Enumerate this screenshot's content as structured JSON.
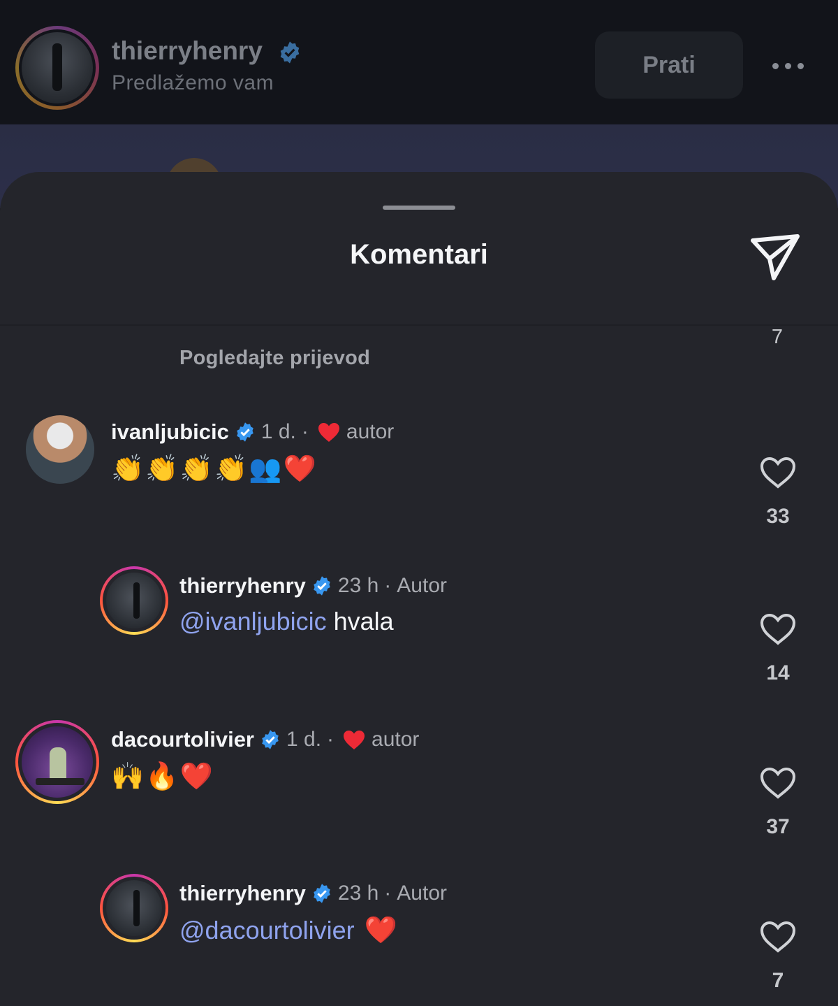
{
  "header": {
    "username": "thierryhenry",
    "subtitle": "Predlažemo vam",
    "follow_label": "Prati"
  },
  "sheet": {
    "title": "Komentari"
  },
  "partial_comment": {
    "like_count": "7",
    "see_translation": "Pogledajte prijevod"
  },
  "comments": [
    {
      "username": "ivanljubicic",
      "time": "1 d.",
      "separator": "·",
      "author_tag": "autor",
      "text": "👏👏👏👏👥❤️",
      "like_count": "33"
    },
    {
      "username": "thierryhenry",
      "time": "23 h",
      "separator": "·",
      "author_tag": "Autor",
      "mention": "@ivanljubicic",
      "text": " hvala",
      "like_count": "14"
    },
    {
      "username": "dacourtolivier",
      "time": "1 d.",
      "separator": "·",
      "author_tag": "autor",
      "text": "🙌🔥❤️",
      "like_count": "37"
    },
    {
      "username": "thierryhenry",
      "time": "23 h",
      "separator": "·",
      "author_tag": "Autor",
      "mention": "@dacourtolivier",
      "text": " ❤️",
      "like_count": "7"
    }
  ],
  "colors": {
    "verified": "#3897f0",
    "mention": "#8fa3ee",
    "heart_red": "#ee2a36",
    "sheet_bg": "#24252b"
  },
  "icons": [
    "verified-badge-icon",
    "heart-icon",
    "share-paper-plane-icon",
    "more-options-icon"
  ]
}
